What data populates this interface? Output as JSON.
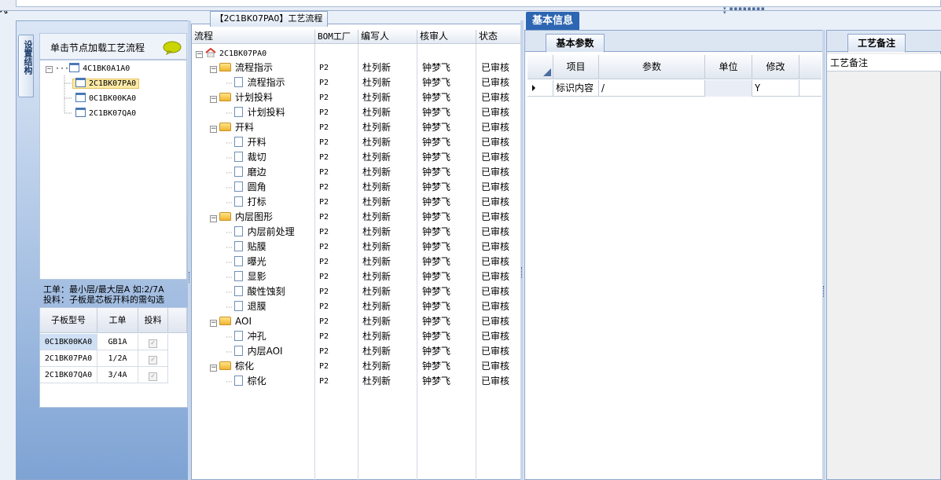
{
  "toolbar": {
    "grip": "▾ ▪▪▪▪▪▪▪▪ ▾"
  },
  "left_panel": {
    "vertical_tab_label": "设置结构",
    "hint": "单击节点加载工艺流程",
    "tree": [
      {
        "code": "4C1BK0A1A0",
        "expanded": true,
        "selected": false
      },
      {
        "code": "2C1BK07PA0",
        "selected": true
      },
      {
        "code": "0C1BK00KA0",
        "selected": false
      },
      {
        "code": "2C1BK07QA0",
        "selected": false
      }
    ],
    "info_line1": "工单：最小层/最大层A 如:2/7A",
    "info_line2": "投料：子板是芯板开料的需勾选",
    "sub_table": {
      "headers": [
        "子板型号",
        "工单",
        "投料"
      ],
      "rows": [
        {
          "model": "0C1BK00KA0",
          "order": "GB1A",
          "feed": true
        },
        {
          "model": "2C1BK07PA0",
          "order": "1/2A",
          "feed": true
        },
        {
          "model": "2C1BK07QA0",
          "order": "3/4A",
          "feed": true
        }
      ]
    }
  },
  "middle_panel": {
    "tab_title": "【2C1BK07PA0】工艺流程",
    "headers": [
      "流程",
      "BOM工厂",
      "编写人",
      "核审人",
      "状态"
    ],
    "root": "2C1BK07PA0",
    "rows": [
      {
        "name": "流程指示",
        "level": 1,
        "bom": "P2",
        "writer": "杜列新",
        "reviewer": "钟梦飞",
        "status": "已审核"
      },
      {
        "name": "流程指示",
        "level": 2,
        "bom": "P2",
        "writer": "杜列新",
        "reviewer": "钟梦飞",
        "status": "已审核"
      },
      {
        "name": "计划投料",
        "level": 1,
        "bom": "P2",
        "writer": "杜列新",
        "reviewer": "钟梦飞",
        "status": "已审核"
      },
      {
        "name": "计划投料",
        "level": 2,
        "bom": "P2",
        "writer": "杜列新",
        "reviewer": "钟梦飞",
        "status": "已审核"
      },
      {
        "name": "开料",
        "level": 1,
        "bom": "P2",
        "writer": "杜列新",
        "reviewer": "钟梦飞",
        "status": "已审核"
      },
      {
        "name": "开料",
        "level": 2,
        "bom": "P2",
        "writer": "杜列新",
        "reviewer": "钟梦飞",
        "status": "已审核"
      },
      {
        "name": "裁切",
        "level": 2,
        "bom": "P2",
        "writer": "杜列新",
        "reviewer": "钟梦飞",
        "status": "已审核"
      },
      {
        "name": "磨边",
        "level": 2,
        "bom": "P2",
        "writer": "杜列新",
        "reviewer": "钟梦飞",
        "status": "已审核"
      },
      {
        "name": "圆角",
        "level": 2,
        "bom": "P2",
        "writer": "杜列新",
        "reviewer": "钟梦飞",
        "status": "已审核"
      },
      {
        "name": "打标",
        "level": 2,
        "bom": "P2",
        "writer": "杜列新",
        "reviewer": "钟梦飞",
        "status": "已审核"
      },
      {
        "name": "内层图形",
        "level": 1,
        "bom": "P2",
        "writer": "杜列新",
        "reviewer": "钟梦飞",
        "status": "已审核"
      },
      {
        "name": "内层前处理",
        "level": 2,
        "bom": "P2",
        "writer": "杜列新",
        "reviewer": "钟梦飞",
        "status": "已审核"
      },
      {
        "name": "贴膜",
        "level": 2,
        "bom": "P2",
        "writer": "杜列新",
        "reviewer": "钟梦飞",
        "status": "已审核"
      },
      {
        "name": "曝光",
        "level": 2,
        "bom": "P2",
        "writer": "杜列新",
        "reviewer": "钟梦飞",
        "status": "已审核"
      },
      {
        "name": "显影",
        "level": 2,
        "bom": "P2",
        "writer": "杜列新",
        "reviewer": "钟梦飞",
        "status": "已审核"
      },
      {
        "name": "酸性蚀刻",
        "level": 2,
        "bom": "P2",
        "writer": "杜列新",
        "reviewer": "钟梦飞",
        "status": "已审核"
      },
      {
        "name": "退膜",
        "level": 2,
        "bom": "P2",
        "writer": "杜列新",
        "reviewer": "钟梦飞",
        "status": "已审核"
      },
      {
        "name": "AOI",
        "level": 1,
        "bom": "P2",
        "writer": "杜列新",
        "reviewer": "钟梦飞",
        "status": "已审核"
      },
      {
        "name": "冲孔",
        "level": 2,
        "bom": "P2",
        "writer": "杜列新",
        "reviewer": "钟梦飞",
        "status": "已审核"
      },
      {
        "name": "内层AOI",
        "level": 2,
        "bom": "P2",
        "writer": "杜列新",
        "reviewer": "钟梦飞",
        "status": "已审核"
      },
      {
        "name": "棕化",
        "level": 1,
        "bom": "P2",
        "writer": "杜列新",
        "reviewer": "钟梦飞",
        "status": "已审核"
      },
      {
        "name": "棕化",
        "level": 2,
        "bom": "P2",
        "writer": "杜列新",
        "reviewer": "钟梦飞",
        "status": "已审核"
      }
    ]
  },
  "right_panel": {
    "tab_title": "基本信息",
    "sub_tab": "基本参数",
    "grid_headers": [
      "项目",
      "参数",
      "单位",
      "修改"
    ],
    "grid_row": {
      "item": "标识内容",
      "param": "/",
      "unit": "",
      "modify": "Y"
    }
  },
  "notes_panel": {
    "tab_title": "工艺备注",
    "header": "工艺备注"
  },
  "colors": {
    "accent": "#2d66b2",
    "selection": "#fde9a6",
    "folder": "#f0b42e"
  }
}
